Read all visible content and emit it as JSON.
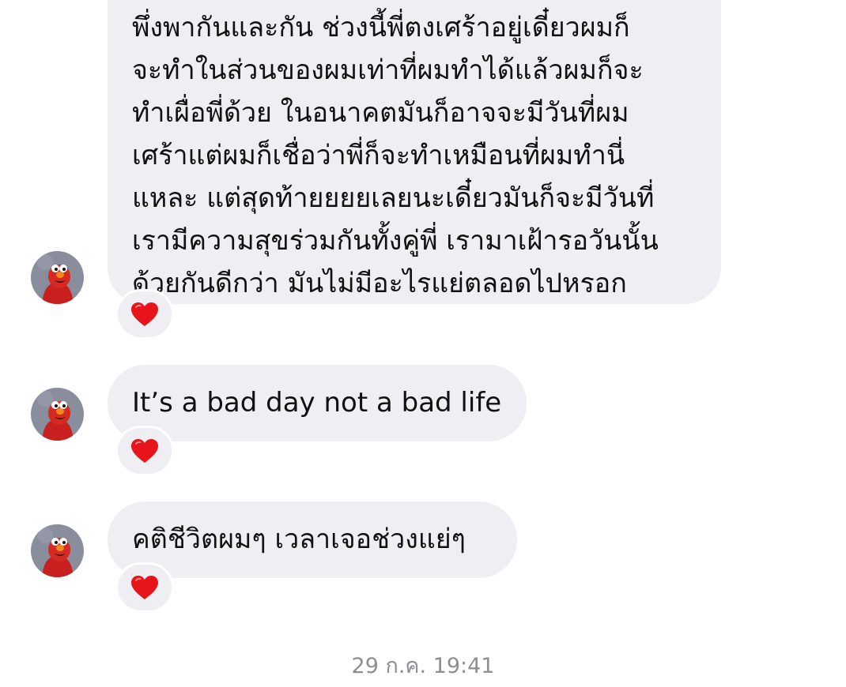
{
  "conversation": {
    "messages": [
      {
        "lines": [
          "พึ่งพากันและกัน ช่วงนี้พี่ตงเศร้าอยู่เดี๋ยวผมก็",
          "จะทำในส่วนของผมเท่าที่ผมทำได้แล้วผมก็จะ",
          "ทำเผื่อพี่ด้วย ในอนาคตมันก็อาจจะมีวันที่ผม",
          "เศร้าแต่ผมก็เชื่อว่าพี่ก็จะทำเหมือนที่ผมทำนี่",
          "แหละ แต่สุดท้ายยยยเลยนะเดี๋ยวมันก็จะมีวันที่",
          "เรามีความสุขร่วมกันทั้งคู่พี่ เรามาเฝ้ารอวันนั้น",
          "ด้วยกันดีกว่า มันไม่มีอะไรแย่ตลอดไปหรอก"
        ],
        "reaction": "red-heart-icon"
      },
      {
        "text": "It’s a bad day not a bad life",
        "reaction": "red-heart-icon"
      },
      {
        "text": "คติชีวิตผมๆ เวลาเจอช่วงแย่ๆ",
        "reaction": "red-heart-icon"
      }
    ],
    "avatar_icon": "elmo-avatar-icon",
    "timestamp": "29 ก.ค. 19:41"
  },
  "colors": {
    "incoming_bubble": "#efeff3",
    "message_text": "#111111",
    "timestamp_text": "#8e8e93",
    "heart": "#e8141c",
    "background": "#ffffff"
  }
}
